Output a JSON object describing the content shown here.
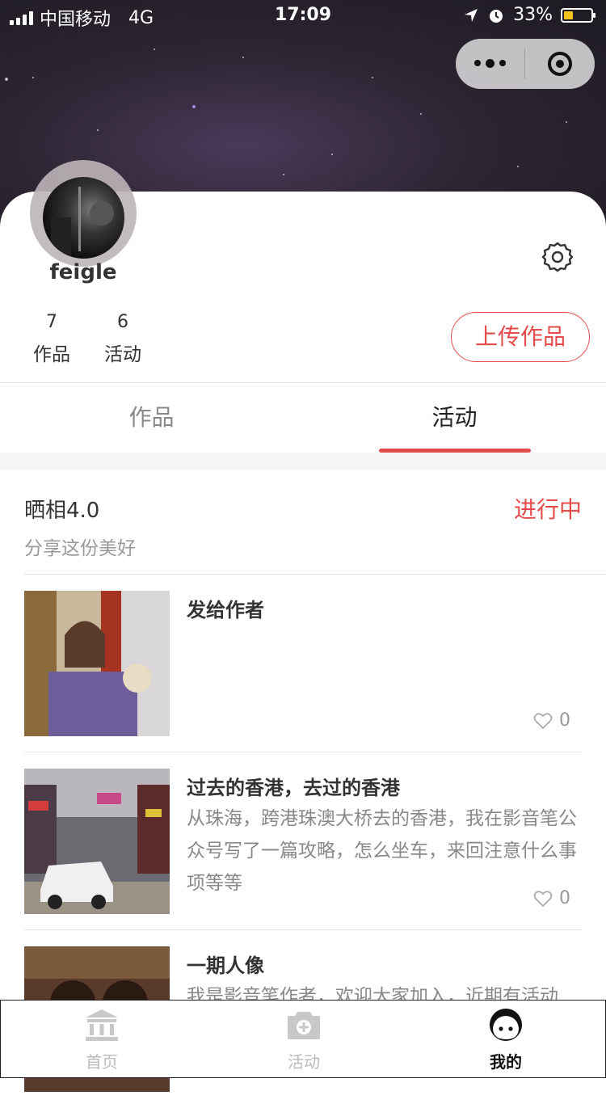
{
  "status_bar": {
    "carrier": "中国移动",
    "network": "4G",
    "time": "17:09",
    "battery": "33%",
    "battery_level": 0.33
  },
  "profile": {
    "username": "feigle",
    "stats": [
      {
        "num": "7",
        "label": "作品"
      },
      {
        "num": "6",
        "label": "活动"
      }
    ],
    "upload_button": "上传作品"
  },
  "tabs": [
    {
      "label": "作品",
      "active": false
    },
    {
      "label": "活动",
      "active": true
    }
  ],
  "activity": {
    "title": "晒相4.0",
    "status": "进行中",
    "subtitle": "分享这份美好",
    "status_color": "#e64b4b"
  },
  "items": [
    {
      "title": "发给作者",
      "desc": "",
      "likes": "0"
    },
    {
      "title": "过去的香港，去过的香港",
      "desc": "从珠海，跨港珠澳大桥去的香港，我在影音笔公众号写了一篇攻略，怎么坐车，来回注意什么事项等等",
      "likes": "0"
    },
    {
      "title": "一期人像",
      "desc": "我是影音笔作者，欢迎大家加入，近期有活动",
      "likes": ""
    }
  ],
  "tabbar": [
    {
      "label": "首页",
      "icon": "bank-icon",
      "active": false
    },
    {
      "label": "活动",
      "icon": "camera-icon",
      "active": false
    },
    {
      "label": "我的",
      "icon": "face-icon",
      "active": true
    }
  ],
  "colors": {
    "accent": "#e64b4b"
  }
}
